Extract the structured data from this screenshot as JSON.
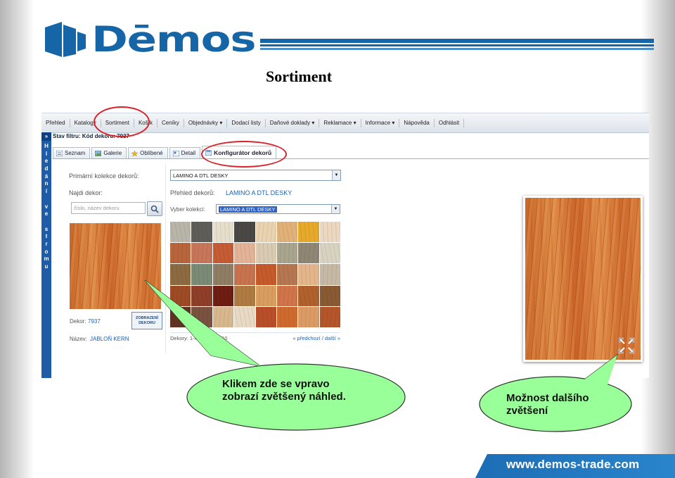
{
  "brand": {
    "logo_text": "Dēmos",
    "color": "#1565a7"
  },
  "slide_title": "Sortiment",
  "navbar": {
    "items": [
      "Přehled",
      "Katalogy",
      "Sortiment",
      "Košík",
      "Ceníky",
      "Objednávky ▾",
      "Dodací listy",
      "Daňové doklady ▾",
      "Reklamace ▾",
      "Informace ▾",
      "Nápověda",
      "Odhlásit"
    ]
  },
  "sidebar": {
    "toggle": "»",
    "letters": [
      "H",
      "l",
      "e",
      "d",
      "á",
      "n",
      "í",
      "",
      "v",
      "e",
      "",
      "s",
      "t",
      "r",
      "o",
      "m",
      "u"
    ]
  },
  "filter": {
    "label": "Stav filtru:",
    "value": "Kód dekoru: 7937"
  },
  "tabs": [
    {
      "label": "Seznam",
      "icon": "list-icon"
    },
    {
      "label": "Galerie",
      "icon": "gallery-icon"
    },
    {
      "label": "Oblíbené",
      "icon": "star-icon"
    },
    {
      "label": "Detail",
      "icon": "detail-icon"
    },
    {
      "label": "Konfigurátor dekorů",
      "icon": "configurator-icon"
    }
  ],
  "form": {
    "primary_collection_label": "Primární kolekce dekorů:",
    "primary_collection_value": "LAMINO A DTL DESKY",
    "find_label": "Najdi dekor:",
    "search_placeholder": "číslo, název dekoru",
    "overview_label": "Přehled dekorů:",
    "overview_value": "LAMINO A DTL DESKY",
    "choose_label": "Vyber kolekci:",
    "choose_value": "LAMINO A DTL DESKY"
  },
  "detail": {
    "zoom_button_line1": "ZOBRAZENÍ",
    "zoom_button_line2": "DEKORU",
    "decor_label": "Dekor:",
    "decor_value": "7937",
    "name_label": "Název:",
    "name_value": "JABLOŇ KERN"
  },
  "gallery": {
    "footer_left": "Dekory: 1-40",
    "footer_mid": "/10",
    "prev": "« předchozí",
    "sep": "/",
    "next": "další »",
    "swatches": [
      "#b9b5a9",
      "#5f5d58",
      "#e6ddca",
      "#4a4845",
      "#e8d2b0",
      "#e0b27a",
      "#e6a92c",
      "#ecd7c0",
      "#b8653c",
      "#c7765a",
      "#c55c34",
      "#e3b397",
      "#d9cbb2",
      "#a9a48d",
      "#8f8774",
      "#d8d2c1",
      "#8c6a42",
      "#7b8a74",
      "#8f7d63",
      "#c8734f",
      "#c55a2a",
      "#b57650",
      "#e2b58a",
      "#c6b9a4",
      "#9e4a25",
      "#8f3e2a",
      "#6e1d12",
      "#b07a43",
      "#d89e60",
      "#d0744a",
      "#b0612c",
      "#8a5a32",
      "#5f3422",
      "#7a5240",
      "#d7b88e",
      "#e8d9c4",
      "#b84e2a",
      "#cf6a2f",
      "#dc9a64",
      "#b5552a"
    ]
  },
  "callouts": {
    "left": [
      "Klikem zde se vpravo",
      "zobrazí  zvětšený náhled."
    ],
    "right": [
      "Možnost dalšího",
      "zvětšení"
    ],
    "fill": "#99ff99"
  },
  "footer": {
    "url": "www.demos-trade.com"
  },
  "accent": "#d9212a"
}
